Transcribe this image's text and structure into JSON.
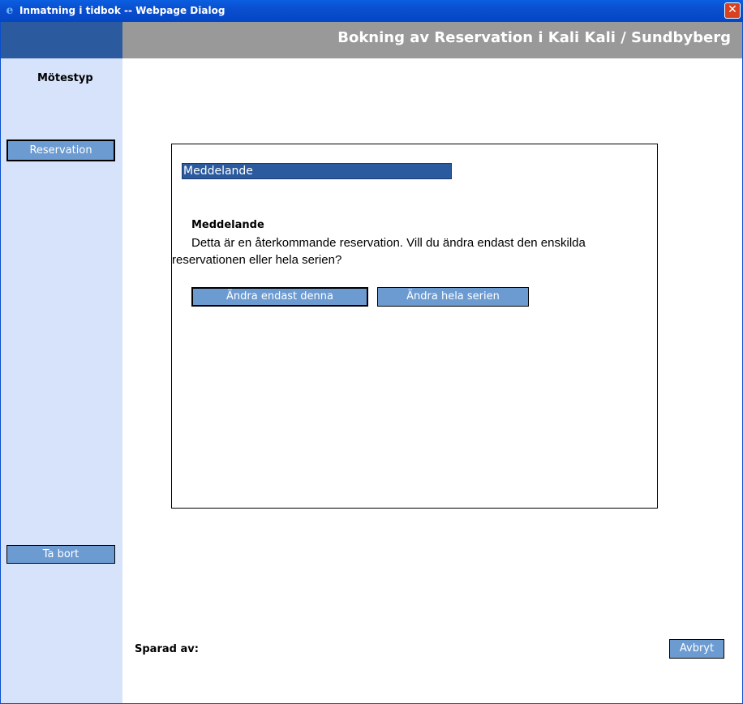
{
  "window": {
    "title": "Inmatning i tidbok -- Webpage Dialog",
    "app_icon": "ie-icon",
    "close_glyph": "✕"
  },
  "header": {
    "title": "Bokning av Reservation  i Kali Kali / Sundbyberg"
  },
  "sidebar": {
    "heading": "Mötestyp",
    "items": [
      {
        "label": "Reservation",
        "active": true
      },
      {
        "label": "Ta bort",
        "active": false
      }
    ]
  },
  "dialog": {
    "caption": "Meddelande",
    "title": "Meddelande",
    "text": "Detta är en återkommande reservation. Vill du ändra endast den enskilda reservationen eller hela serien?",
    "buttons": {
      "only_this": "Ändra endast denna",
      "whole_series": "Ändra hela serien"
    }
  },
  "footer": {
    "saved_by_label": "Sparad av:",
    "cancel_label": "Avbryt"
  },
  "colors": {
    "titlebar": "#0a4fd0",
    "header_band": "#999999",
    "sidebar_bg": "#d6e3fb",
    "accent_dark": "#2b5b9e",
    "button_bg": "#6c9bd2"
  }
}
